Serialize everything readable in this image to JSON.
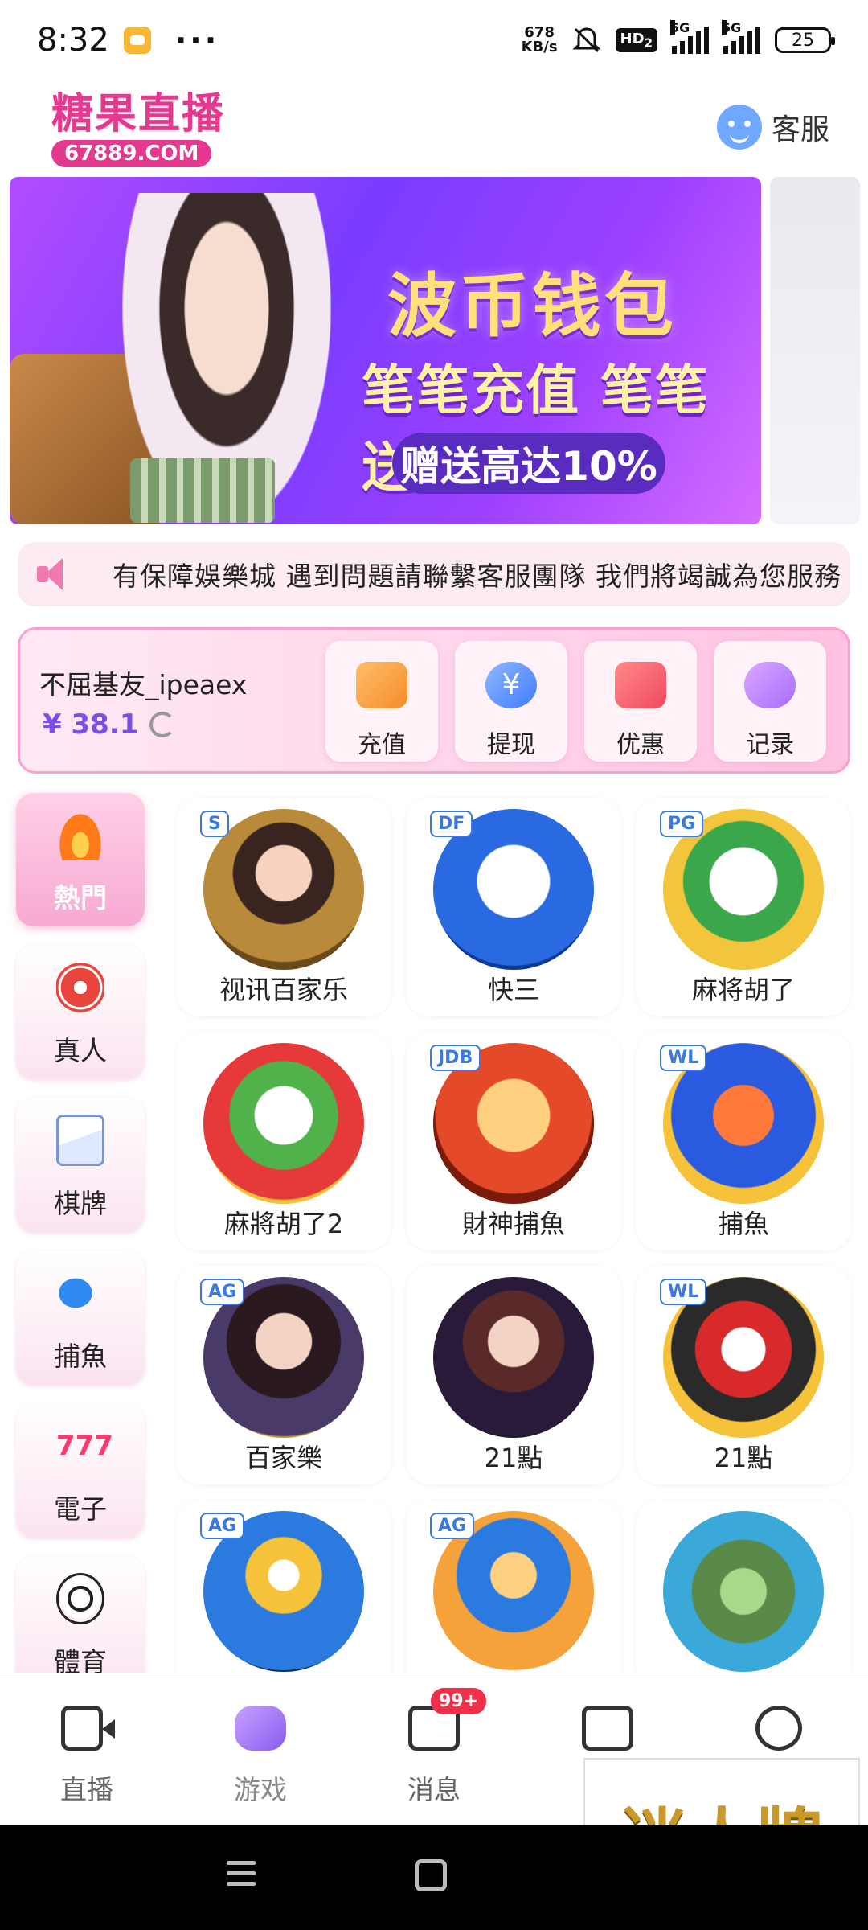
{
  "status_bar": {
    "time": "8:32",
    "dots": "···",
    "net_speed_value": "678",
    "net_speed_unit": "KB/s",
    "hd_label": "HD",
    "hd_sub": "2",
    "signal1_label": "5G",
    "signal2_label": "5G",
    "battery": "25"
  },
  "header": {
    "logo_text": "糖果直播",
    "logo_domain": "67889.COM",
    "service_label": "客服"
  },
  "banner": {
    "title": "波币钱包",
    "subtitle": "笔笔充值 笔笔送",
    "pill": "赠送高达10%",
    "slide_count": 4,
    "active_slide": 2
  },
  "marquee": {
    "text": "有保障娛樂城  遇到問題請聯繫客服團隊 我們將竭誠為您服務"
  },
  "user": {
    "name": "不屈基友_ipeaex",
    "balance": "¥ 38.1"
  },
  "actions": [
    {
      "label": "充值",
      "icon": "wallet-icon"
    },
    {
      "label": "提现",
      "icon": "yen-icon"
    },
    {
      "label": "优惠",
      "icon": "ticket-icon"
    },
    {
      "label": "记录",
      "icon": "gamepad-icon"
    }
  ],
  "categories": [
    {
      "label": "熱門",
      "icon": "flame-icon",
      "active": true
    },
    {
      "label": "真人",
      "icon": "poker-chip-icon"
    },
    {
      "label": "棋牌",
      "icon": "playing-cards-icon"
    },
    {
      "label": "捕魚",
      "icon": "shark-icon"
    },
    {
      "label": "電子",
      "icon": "slot-777-icon"
    },
    {
      "label": "體育",
      "icon": "soccer-ball-icon"
    }
  ],
  "games": [
    {
      "label": "视讯百家乐",
      "tag": "S"
    },
    {
      "label": "快三",
      "tag": "DF"
    },
    {
      "label": "麻将胡了",
      "tag": "PG"
    },
    {
      "label": "麻將胡了2",
      "tag": ""
    },
    {
      "label": "財神捕魚",
      "tag": "JDB"
    },
    {
      "label": "捕魚",
      "tag": "WL"
    },
    {
      "label": "百家樂",
      "tag": "AG"
    },
    {
      "label": "21點",
      "tag": ""
    },
    {
      "label": "21點",
      "tag": "WL"
    },
    {
      "label": "",
      "tag": "AG"
    },
    {
      "label": "",
      "tag": "AG"
    },
    {
      "label": "",
      "tag": ""
    }
  ],
  "bottom_nav": [
    {
      "label": "直播",
      "icon": "video-camera-icon"
    },
    {
      "label": "游戏",
      "icon": "gamepad-icon",
      "active": true
    },
    {
      "label": "消息",
      "icon": "message-icon",
      "badge": "99+"
    },
    {
      "label": "",
      "icon": "wallet-icon"
    },
    {
      "label": "",
      "icon": "smiley-icon"
    }
  ],
  "watermark": {
    "text": "迷人牌"
  },
  "colors": {
    "brand_pink": "#e5388f",
    "balance_purple": "#7b4ee8",
    "badge_red": "#f0304a"
  }
}
